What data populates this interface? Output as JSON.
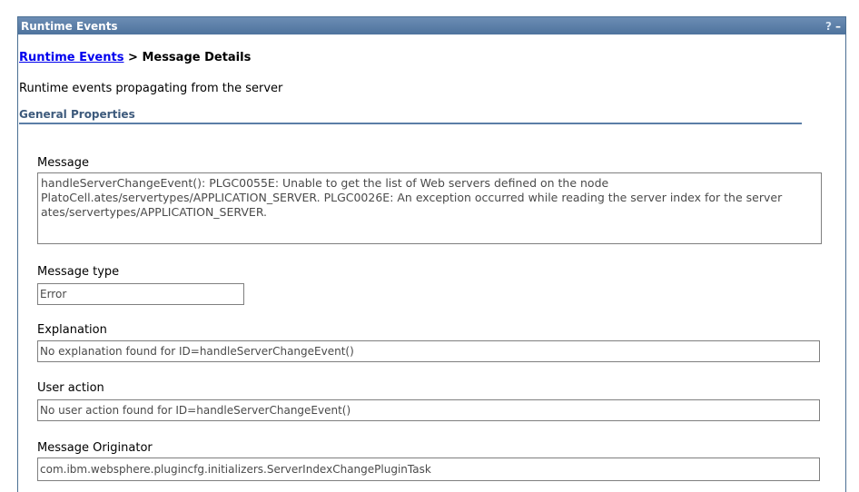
{
  "window": {
    "title": "Runtime Events",
    "help_label": "?",
    "minimize_label": "–"
  },
  "breadcrumb": {
    "link_label": "Runtime Events",
    "separator": ">",
    "current": "Message Details"
  },
  "description": "Runtime events propagating from the server",
  "section_title": "General Properties",
  "fields": {
    "message": {
      "label": "Message",
      "value": "handleServerChangeEvent(): PLGC0055E: Unable to get the list of Web servers defined on the node PlatoCell.ates/servertypes/APPLICATION_SERVER. PLGC0026E: An exception occurred while reading the server index for the server ates/servertypes/APPLICATION_SERVER."
    },
    "message_type": {
      "label": "Message type",
      "value": "Error"
    },
    "explanation": {
      "label": "Explanation",
      "value": "No explanation found for ID=handleServerChangeEvent()"
    },
    "user_action": {
      "label": "User action",
      "value": "No user action found for ID=handleServerChangeEvent()"
    },
    "originator": {
      "label": "Message Originator",
      "value": "com.ibm.websphere.plugincfg.initializers.ServerIndexChangePluginTask"
    }
  },
  "colors": {
    "titlebar": "#5b7ea7",
    "link": "#0000ee",
    "section_rule": "#5b7ea7"
  }
}
